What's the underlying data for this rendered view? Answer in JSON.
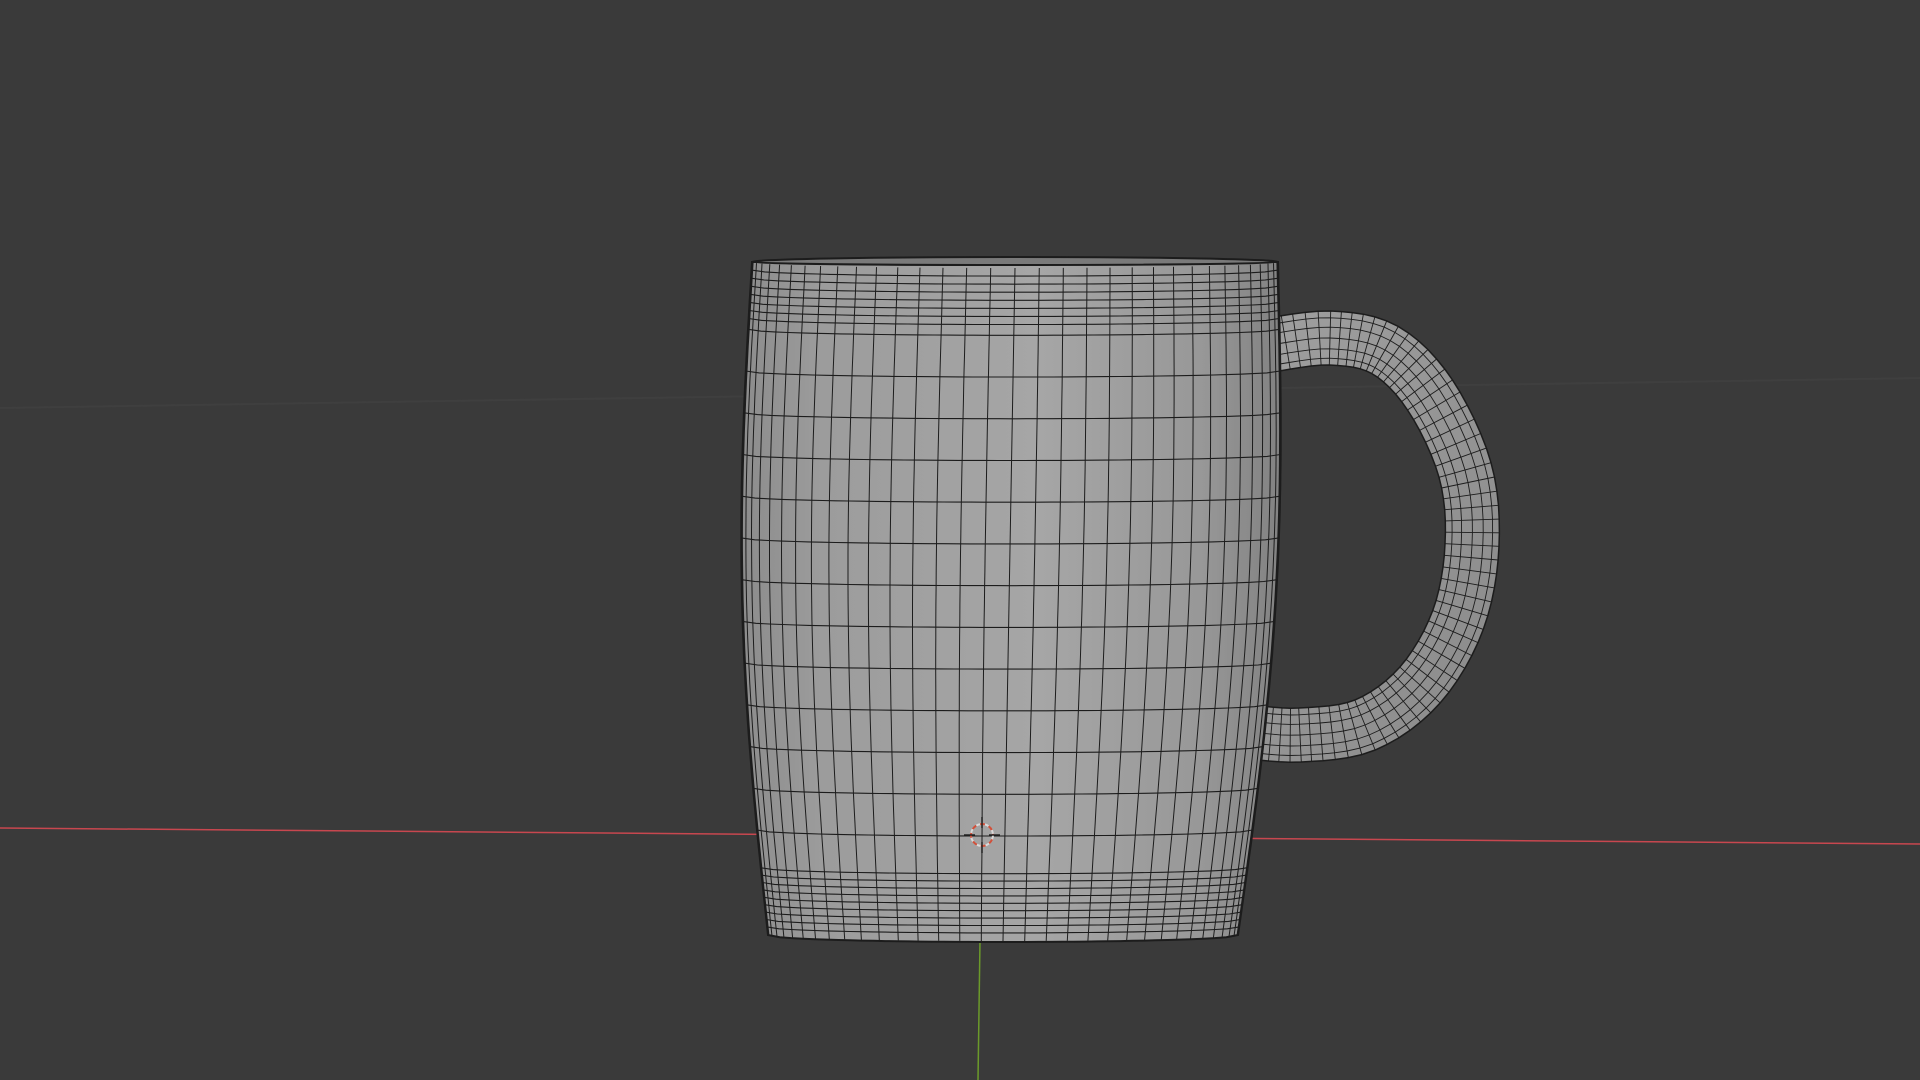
{
  "viewport": {
    "mode": "3d-viewport",
    "background_color": "#3a3a3a",
    "shading": "solid-wireframe-overlay",
    "axis_x_color": "#c8474f",
    "axis_y_color": "#6b9a2a",
    "mesh_color": "#a2a2a2",
    "wire_color": "#1c1c1c",
    "object": "mug",
    "cursor_icon": "3d-cursor-icon"
  }
}
